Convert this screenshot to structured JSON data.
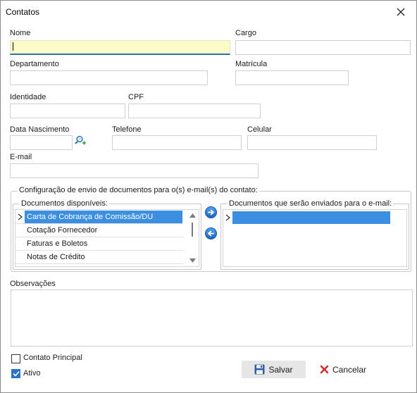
{
  "window": {
    "title": "Contatos"
  },
  "fields": {
    "nome": {
      "label": "Nome",
      "value": ""
    },
    "cargo": {
      "label": "Cargo",
      "value": ""
    },
    "departamento": {
      "label": "Departamento",
      "value": ""
    },
    "matricula": {
      "label": "Matrícula",
      "value": ""
    },
    "identidade": {
      "label": "Identidade",
      "value": ""
    },
    "cpf": {
      "label": "CPF",
      "value": ""
    },
    "data_nascimento": {
      "label": "Data Nascimento",
      "value": ""
    },
    "telefone": {
      "label": "Telefone",
      "value": ""
    },
    "celular": {
      "label": "Celular",
      "value": ""
    },
    "email": {
      "label": "E-mail",
      "value": ""
    }
  },
  "docs_config": {
    "title": "Configuração de envio de documentos para o(s) e-mail(s) do contato:",
    "available": {
      "title": "Documentos disponíveis:",
      "items": [
        "Carta de Cobrança de Comissão/DU",
        "Cotação Fornecedor",
        "Faturas e Boletos",
        "Notas de Crédito"
      ],
      "selected_index": 0
    },
    "to_send": {
      "title": "Documentos que serão enviados para o e-mail:",
      "items": [
        ""
      ]
    },
    "add_icon": "arrow-right-icon",
    "remove_icon": "arrow-left-icon"
  },
  "observacoes": {
    "label": "Observações",
    "value": ""
  },
  "checks": {
    "contato_principal": {
      "label": "Contato Principal",
      "checked": false
    },
    "ativo": {
      "label": "Ativo",
      "checked": true
    }
  },
  "buttons": {
    "salvar": "Salvar",
    "cancelar": "Cancelar"
  },
  "colors": {
    "accent": "#3c8fe0",
    "focus_field": "#fdfbc8",
    "cancel_x": "#d9262b"
  }
}
